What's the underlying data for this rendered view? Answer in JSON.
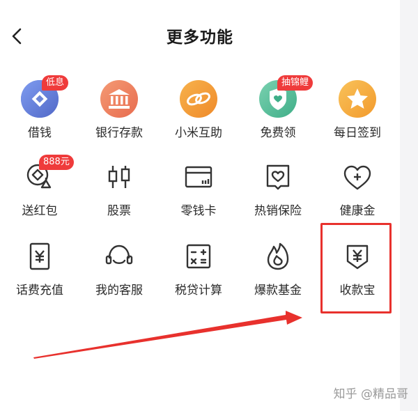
{
  "header": {
    "title": "更多功能"
  },
  "items": [
    {
      "label": "借钱",
      "badge": "低息"
    },
    {
      "label": "银行存款"
    },
    {
      "label": "小米互助"
    },
    {
      "label": "免费领",
      "badge": "抽锦鲤"
    },
    {
      "label": "每日签到"
    },
    {
      "label": "送红包",
      "badge": "888元"
    },
    {
      "label": "股票"
    },
    {
      "label": "零钱卡"
    },
    {
      "label": "热销保险"
    },
    {
      "label": "健康金"
    },
    {
      "label": "话费充值"
    },
    {
      "label": "我的客服"
    },
    {
      "label": "税贷计算"
    },
    {
      "label": "爆款基金"
    },
    {
      "label": "收款宝"
    }
  ],
  "watermark": "知乎 @精品哥",
  "colors": {
    "accent_red": "#e8312d",
    "badge_red": "#ef3b3b",
    "icon_stroke": "#333333"
  }
}
